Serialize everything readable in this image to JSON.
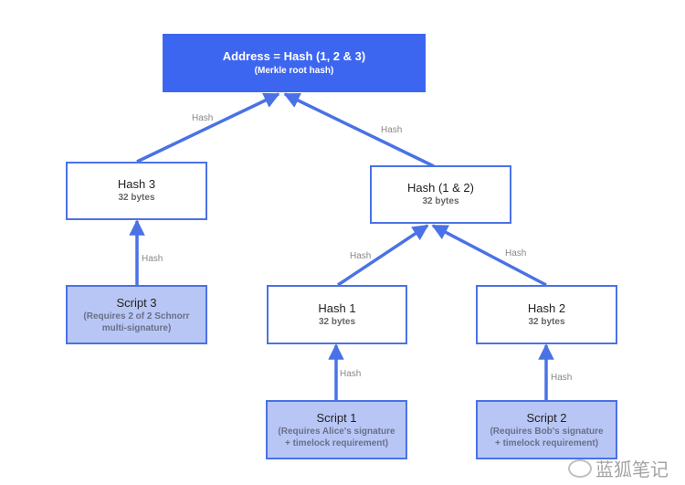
{
  "colors": {
    "root_fill": "#3d66f0",
    "edge": "#4a72e6",
    "script_fill": "#b8c6f5",
    "node_fill": "#ffffff"
  },
  "nodes": {
    "root": {
      "title": "Address = Hash (1, 2 & 3)",
      "subtitle": "(Merkle root hash)"
    },
    "hash3": {
      "title": "Hash 3",
      "subtitle": "32 bytes"
    },
    "hash12": {
      "title": "Hash (1 & 2)",
      "subtitle": "32 bytes"
    },
    "hash1": {
      "title": "Hash 1",
      "subtitle": "32 bytes"
    },
    "hash2": {
      "title": "Hash 2",
      "subtitle": "32 bytes"
    },
    "script3": {
      "title": "Script 3",
      "subtitle": "(Requires 2 of 2 Schnorr multi-signature)"
    },
    "script1": {
      "title": "Script 1",
      "subtitle": "(Requires Alice's signature + timelock requirement)"
    },
    "script2": {
      "title": "Script 2",
      "subtitle": "(Requires Bob's signature + timelock requirement)"
    }
  },
  "edges": [
    {
      "from": "hash3",
      "to": "root",
      "label": "Hash"
    },
    {
      "from": "hash12",
      "to": "root",
      "label": "Hash"
    },
    {
      "from": "script3",
      "to": "hash3",
      "label": "Hash"
    },
    {
      "from": "hash1",
      "to": "hash12",
      "label": "Hash"
    },
    {
      "from": "hash2",
      "to": "hash12",
      "label": "Hash"
    },
    {
      "from": "script1",
      "to": "hash1",
      "label": "Hash"
    },
    {
      "from": "script2",
      "to": "hash2",
      "label": "Hash"
    }
  ],
  "watermark": {
    "text": "蓝狐笔记",
    "icon": "wechat-icon"
  }
}
